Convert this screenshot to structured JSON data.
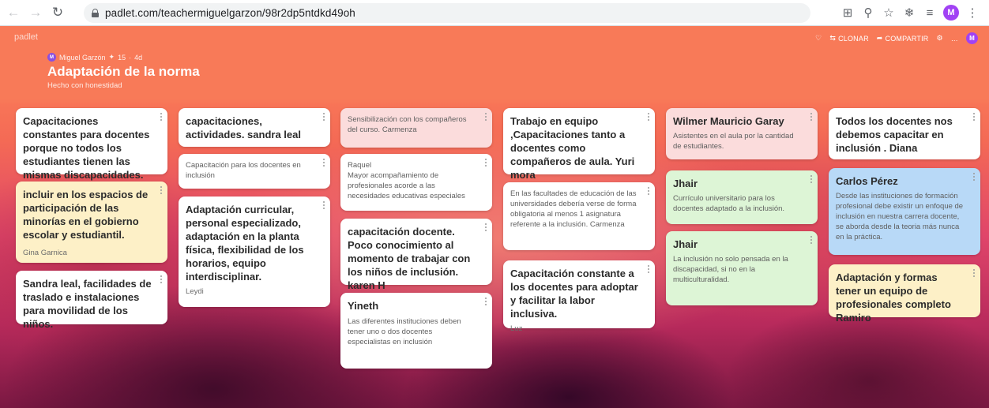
{
  "browser": {
    "url": "padlet.com/teachermiguelgarzon/98r2dp5ntdkd49oh",
    "profile_initial": "M"
  },
  "padlet": {
    "brand": "padlet",
    "actions": {
      "clone": "CLONAR",
      "share": "COMPARTIR",
      "more": "…"
    },
    "avatar_initial": "M",
    "author": "Miguel Garzón",
    "points": "15",
    "age": "4d",
    "title": "Adaptación de la norma",
    "subtitle": "Hecho con honestidad"
  },
  "columns": [
    [
      {
        "title": "Capacitaciones constantes para docentes porque no todos los estudiantes tienen las mismas discapacidades.",
        "body": "",
        "author": "",
        "color": "white"
      },
      {
        "title": "incluir en los espacios de participación de las minorías en el gobierno escolar y estudiantil.",
        "body": "",
        "author": "Gina Garnica",
        "color": "yellow"
      },
      {
        "title": "Sandra leal, facilidades de traslado e instalaciones para movilidad de los niños.",
        "body": "",
        "author": "",
        "color": "white"
      }
    ],
    [
      {
        "title": "capacitaciones, actividades. sandra leal",
        "body": "",
        "author": "",
        "color": "white"
      },
      {
        "title": "",
        "body": "Capacitación para los docentes en inclusión",
        "author": "",
        "color": "white"
      },
      {
        "title": "Adaptación curricular, personal especializado, adaptación en la planta física, flexibilidad de los horarios, equipo interdisciplinar.",
        "body": "",
        "author": "Leydi",
        "color": "white"
      }
    ],
    [
      {
        "title": "",
        "body": "Sensibilización con los compañeros del curso. Carmenza",
        "author": "",
        "color": "pink"
      },
      {
        "title": "",
        "body": "Raquel\nMayor acompañamiento de profesionales acorde a las necesidades educativas especiales",
        "author": "",
        "color": "white"
      },
      {
        "title": "capacitación docente. Poco conocimiento al momento de trabajar con los niños de inclusión. karen H",
        "body": "",
        "author": "",
        "color": "white"
      },
      {
        "title": "Yineth",
        "body": "Las diferentes instituciones deben tener uno o dos docentes especialistas en inclusión",
        "author": "",
        "color": "white"
      }
    ],
    [
      {
        "title": "Trabajo en equipo ,Capacitaciones tanto a docentes como compañeros de aula. Yuri mora",
        "body": "",
        "author": "",
        "color": "white"
      },
      {
        "title": "",
        "body": "En las facultades de educación de las universidades debería verse de forma obligatoria al menos 1 asignatura referente a la inclusión. Carmenza",
        "author": "",
        "color": "white"
      },
      {
        "title": "Capacitación constante a los docentes para adoptar y facilitar la labor inclusiva.",
        "body": "",
        "author": "Luz",
        "color": "white"
      }
    ],
    [
      {
        "title": "Wilmer Mauricio Garay",
        "body": "Asistentes en el aula por la cantidad de estudiantes.",
        "author": "",
        "color": "pink"
      },
      {
        "title": "Jhair",
        "body": "Currículo universitario para los docentes adaptado a la inclusión.",
        "author": "",
        "color": "green"
      },
      {
        "title": "Jhair",
        "body": "La inclusión no solo pensada en la discapacidad, si no en la multiculturalidad.",
        "author": "",
        "color": "green"
      }
    ],
    [
      {
        "title": "Todos los docentes nos debemos capacitar en inclusión . Diana",
        "body": "",
        "author": "",
        "color": "white"
      },
      {
        "title": "Carlos Pérez",
        "body": "Desde las instituciones de formación profesional debe existir un enfoque de inclusión en nuestra carrera docente, se aborda desde la teoria más nunca en la práctica.",
        "author": "",
        "color": "blue"
      },
      {
        "title": "Adaptación y formas tener un equipo de profesionales completo Ramiro",
        "body": "",
        "author": "",
        "color": "yellow"
      }
    ]
  ]
}
